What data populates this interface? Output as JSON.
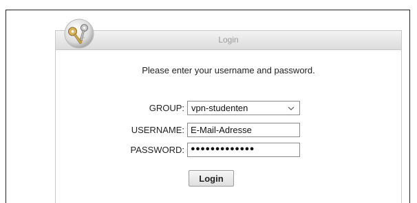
{
  "login_panel": {
    "title": "Login",
    "icon": "keys-icon",
    "instructions": "Please enter your username and password."
  },
  "form": {
    "group_label": "GROUP:",
    "group_selected": "vpn-studenten",
    "username_label": "USERNAME:",
    "username_value": "E-Mail-Adresse",
    "password_label": "PASSWORD:",
    "password_masked": "●●●●●●●●●●●●●",
    "login_button_label": "Login"
  },
  "colors": {
    "title_text": "#9a9a9a",
    "panel_border": "#c8c8c8",
    "frame_border": "#222222"
  }
}
